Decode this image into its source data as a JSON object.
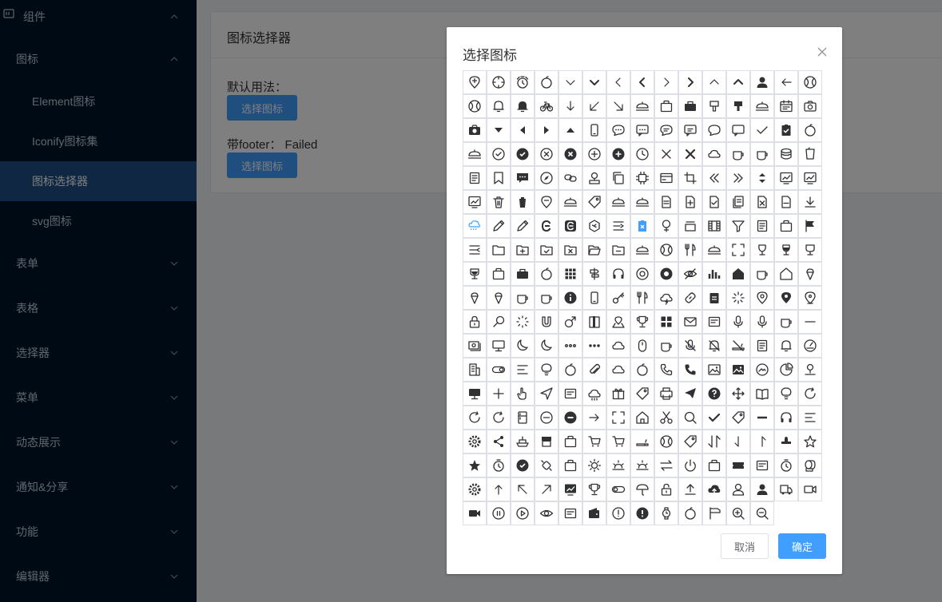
{
  "sidebar": {
    "items": [
      {
        "label": "组件",
        "level": "top",
        "expanded": true
      },
      {
        "label": "图标",
        "level": "top",
        "expanded": true
      },
      {
        "label": "Element图标",
        "level": "sub"
      },
      {
        "label": "Iconify图标集",
        "level": "sub"
      },
      {
        "label": "图标选择器",
        "level": "sub",
        "active": true
      },
      {
        "label": "svg图标",
        "level": "sub"
      },
      {
        "label": "表单",
        "level": "top"
      },
      {
        "label": "表格",
        "level": "top"
      },
      {
        "label": "选择器",
        "level": "top"
      },
      {
        "label": "菜单",
        "level": "top"
      },
      {
        "label": "动态展示",
        "level": "top"
      },
      {
        "label": "通知&分享",
        "level": "top"
      },
      {
        "label": "功能",
        "level": "top"
      },
      {
        "label": "编辑器",
        "level": "top"
      }
    ]
  },
  "page": {
    "title": "图标选择器",
    "default_label": "默认用法：",
    "default_button": "选择图标",
    "footer_label": "带footer：",
    "footer_status": "Failed",
    "footer_button": "选择图标"
  },
  "dialog": {
    "title": "选择图标",
    "cancel_label": "取消",
    "ok_label": "确定",
    "icons": [
      "add-location",
      "aim",
      "alarm-clock",
      "apple",
      "arrow-down",
      "arrow-down-bold",
      "arrow-left",
      "arrow-left-bold",
      "arrow-right",
      "arrow-right-bold",
      "arrow-up",
      "arrow-up-bold",
      "avatar",
      "back",
      "baseball",
      "basketball",
      "bell",
      "bell-filled",
      "bicycle",
      "bottom",
      "bottom-left",
      "bottom-right",
      "bowl",
      "box",
      "briefcase",
      "brush",
      "brush-filled",
      "burger",
      "calendar",
      "camera",
      "camera-filled",
      "caret-bottom",
      "caret-left",
      "caret-right",
      "caret-top",
      "cellphone",
      "chat-dot-round",
      "chat-dot-square",
      "chat-line-round",
      "chat-line-square",
      "chat-round",
      "chat-square",
      "check",
      "checked",
      "cherry",
      "chicken",
      "circle-check",
      "circle-check-filled",
      "circle-close",
      "circle-close-filled",
      "circle-plus",
      "circle-plus-filled",
      "clock",
      "close",
      "close-bold",
      "cloudy",
      "coffee",
      "coffee-cup",
      "coin",
      "cold-drink",
      "collection",
      "collection-tag",
      "comment",
      "compass",
      "connection",
      "coordinate",
      "copy-document",
      "cpu",
      "credit-card",
      "crop",
      "d-arrow-left",
      "d-arrow-right",
      "d-caret",
      "data-analysis",
      "data-board",
      "data-line",
      "delete",
      "delete-filled",
      "delete-location",
      "dessert",
      "discount",
      "dish",
      "dish-dot",
      "document",
      "document-add",
      "document-checked",
      "document-copy",
      "document-delete",
      "document-remove",
      "download",
      "drizzling",
      "edit",
      "edit-pen",
      "eleme",
      "eleme-filled",
      "element-plus",
      "expand",
      "failed",
      "female",
      "files",
      "film",
      "filter",
      "finished",
      "first-aid-kit",
      "flag",
      "fold",
      "folder",
      "folder-add",
      "folder-checked",
      "folder-delete",
      "folder-opened",
      "folder-remove",
      "food",
      "football",
      "fork-spoon",
      "fries",
      "full-screen",
      "goblet",
      "goblet-full",
      "goblet-square",
      "goblet-square-full",
      "goods",
      "goods-filled",
      "grape",
      "grid",
      "guide",
      "headset",
      "help",
      "help-filled",
      "hide",
      "histogram",
      "home-filled",
      "hot-water",
      "house",
      "ice-cream",
      "ice-cream-round",
      "ice-cream-square",
      "ice-drink",
      "ice-tea",
      "info-filled",
      "iphone",
      "key",
      "knife-fork",
      "lightning",
      "link",
      "list",
      "loading",
      "location",
      "location-filled",
      "location-information",
      "lock",
      "lollipop",
      "magic-stick",
      "magnet",
      "male",
      "management",
      "map-location",
      "medal",
      "menu",
      "message",
      "message-box",
      "mic",
      "microphone",
      "milk-tea",
      "minus",
      "money",
      "monitor",
      "moon",
      "moon-night",
      "more",
      "more-filled",
      "mostly-cloudy",
      "mouse",
      "mug",
      "mute",
      "mute-notification",
      "no-smoking",
      "notebook",
      "notification",
      "odometer",
      "office-building",
      "open",
      "operation",
      "opportunity",
      "orange",
      "paperclip",
      "partly-cloudy",
      "pear",
      "phone",
      "phone-filled",
      "picture",
      "picture-filled",
      "picture-rounded",
      "pie-chart",
      "place",
      "platform",
      "plus",
      "pointer",
      "position",
      "postcard",
      "pouring",
      "present",
      "price-tag",
      "printer",
      "promotion",
      "question-filled",
      "rank",
      "reading",
      "reading-lamp",
      "refresh",
      "refresh-left",
      "refresh-right",
      "refrigerator",
      "remove",
      "remove-filled",
      "right",
      "scale-to-original",
      "school",
      "scissor",
      "search",
      "select",
      "sell",
      "semi-select",
      "service",
      "set-up",
      "setting",
      "share",
      "ship",
      "shop",
      "shopping-bag",
      "shopping-cart",
      "shopping-cart-full",
      "smoking",
      "soccer",
      "sold-out",
      "sort",
      "sort-down",
      "sort-up",
      "stamp",
      "star",
      "star-filled",
      "stopwatch",
      "success-filled",
      "sugar",
      "suitcase",
      "sunny",
      "sunrise",
      "sunset",
      "switch",
      "switch-button",
      "takeaway-box",
      "ticket",
      "tickets",
      "timer",
      "toilet-paper",
      "tools",
      "top",
      "top-left",
      "top-right",
      "trend-charts",
      "trophy",
      "turn-off",
      "umbrella",
      "unlock",
      "upload",
      "upload-filled",
      "user",
      "user-filled",
      "van",
      "video-camera",
      "video-camera-filled",
      "video-pause",
      "video-play",
      "view",
      "wallet",
      "wallet-filled",
      "warning",
      "warning-filled",
      "watch",
      "watermelon",
      "wind-power",
      "zoom-in",
      "zoom-out"
    ]
  },
  "colors": {
    "sidebar_bg": "#001529",
    "sidebar_active": "#1f4e85",
    "primary": "#409eff",
    "icon": "#303133",
    "icon_highlight": "#409eff"
  }
}
